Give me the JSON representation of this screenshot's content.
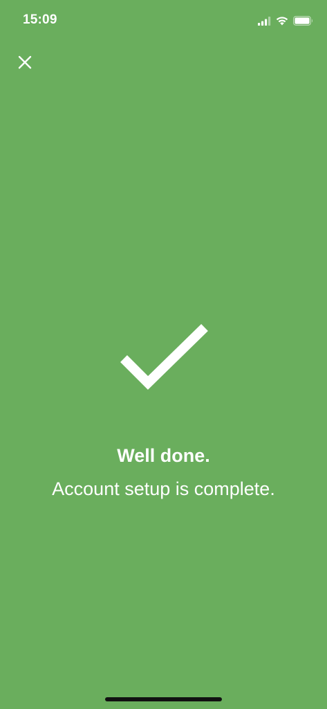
{
  "status_bar": {
    "time": "15:09",
    "icons": [
      "signal-icon",
      "wifi-icon",
      "battery-icon"
    ]
  },
  "toolbar": {
    "close_icon": "close-icon"
  },
  "main": {
    "icon": "checkmark-icon",
    "title": "Well done.",
    "subtitle": "Account setup is complete."
  },
  "colors": {
    "background": "#6aae5d",
    "foreground": "#ffffff",
    "home_indicator": "#111111"
  }
}
